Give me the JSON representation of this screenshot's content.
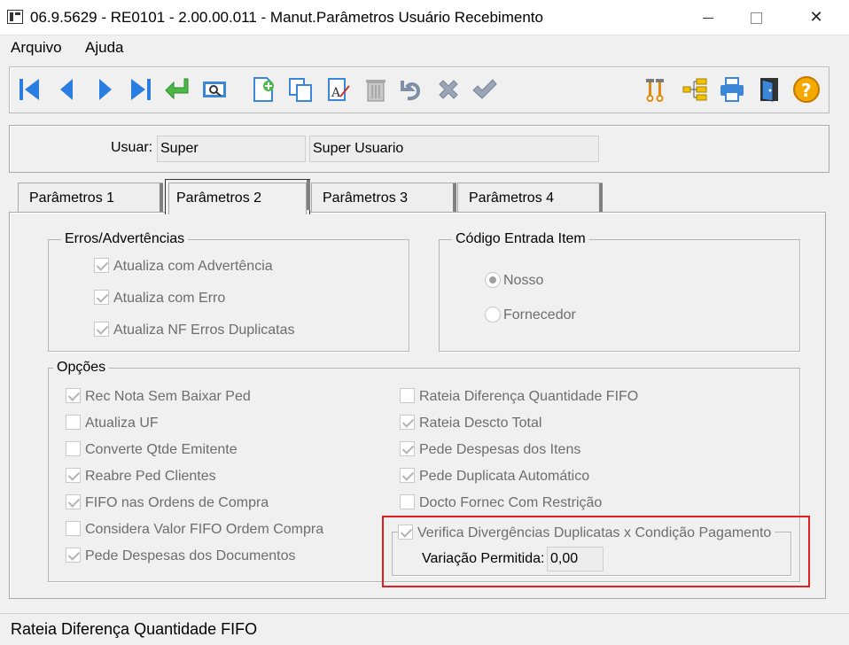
{
  "window": {
    "title": "06.9.5629 - RE0101 - 2.00.00.011 - Manut.Parâmetros Usuário Recebimento",
    "minimize_icon": "minimize-icon",
    "maximize_icon": "maximize-icon",
    "close_glyph": "✕"
  },
  "menu": {
    "items": [
      "Arquivo",
      "Ajuda"
    ]
  },
  "toolbar": {
    "icons": [
      "first-record-icon",
      "previous-record-icon",
      "next-record-icon",
      "last-record-icon",
      "go-to-icon",
      "search-icon",
      "new-record-icon",
      "copy-record-icon",
      "edit-record-icon",
      "delete-record-icon",
      "undo-icon",
      "cancel-icon",
      "save-icon",
      "tools-icon",
      "tree-icon",
      "print-icon",
      "exit-icon",
      "help-icon"
    ]
  },
  "user": {
    "label": "Usuar:",
    "code": "Super",
    "name": "Super Usuario"
  },
  "tabs": [
    "Parâmetros 1",
    "Parâmetros 2",
    "Parâmetros 3",
    "Parâmetros 4"
  ],
  "active_tab": "Parâmetros 2",
  "erros": {
    "title": "Erros/Advertências",
    "items": [
      {
        "label": "Atualiza com Advertência",
        "checked": true
      },
      {
        "label": "Atualiza com Erro",
        "checked": true
      },
      {
        "label": "Atualiza NF Erros Duplicatas",
        "checked": true
      }
    ]
  },
  "codigo": {
    "title": "Código Entrada Item",
    "options": [
      {
        "label": "Nosso",
        "selected": true
      },
      {
        "label": "Fornecedor",
        "selected": false
      }
    ]
  },
  "opcoes": {
    "title": "Opções",
    "left": [
      {
        "label": "Rec Nota Sem Baixar Ped",
        "checked": true
      },
      {
        "label": "Atualiza UF",
        "checked": false
      },
      {
        "label": "Converte Qtde Emitente",
        "checked": false
      },
      {
        "label": "Reabre Ped Clientes",
        "checked": true
      },
      {
        "label": "FIFO nas Ordens de Compra",
        "checked": true
      },
      {
        "label": "Considera Valor FIFO Ordem Compra",
        "checked": false
      },
      {
        "label": "Pede Despesas dos Documentos",
        "checked": true
      }
    ],
    "right": [
      {
        "label": "Rateia Diferença Quantidade FIFO",
        "checked": false
      },
      {
        "label": "Rateia Descto Total",
        "checked": true
      },
      {
        "label": "Pede Despesas dos Itens",
        "checked": true
      },
      {
        "label": "Pede Duplicata Automático",
        "checked": true
      },
      {
        "label": "Docto Fornec Com Restrição",
        "checked": false
      }
    ],
    "verifica": {
      "label": "Verifica Divergências Duplicatas x Condição Pagamento",
      "checked": true
    },
    "variacao_label": "Variação Permitida:",
    "variacao_value": "0,00"
  },
  "status": "Rateia Diferença Quantidade FIFO"
}
